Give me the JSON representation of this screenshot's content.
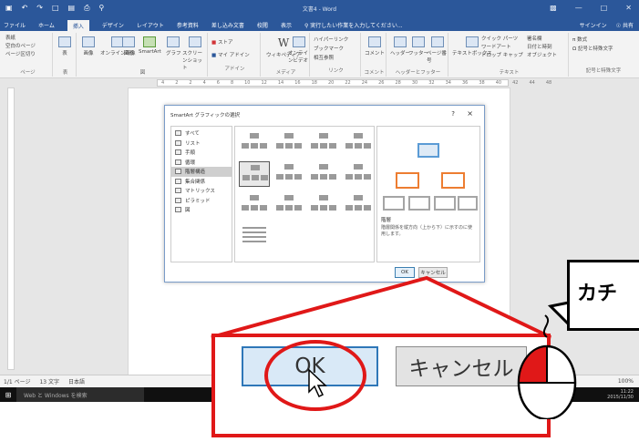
{
  "window": {
    "title": "文書4 - Word",
    "user": "サインイン",
    "share": "共有",
    "tell_me": "実行したい作業を入力してください..."
  },
  "ribbon_tabs": [
    "ファイル",
    "ホーム",
    "挿入",
    "デザイン",
    "レイアウト",
    "参考資料",
    "差し込み文書",
    "校閲",
    "表示"
  ],
  "ribbon": {
    "pages_group": {
      "items": [
        "表紙",
        "空白のページ",
        "ページ区切り"
      ],
      "label": "ページ"
    },
    "table_group": {
      "button": "表",
      "label": "表"
    },
    "illustrations_group": {
      "buttons": [
        "画像",
        "オンライン画像",
        "図形",
        "SmartArt",
        "グラフ",
        "スクリーンショット"
      ],
      "label": "図"
    },
    "addins_group": {
      "items": [
        "ストア",
        "マイ アドイン"
      ],
      "label": "アドイン"
    },
    "media_group": {
      "buttons": [
        "ウィキペディア",
        "オンラインビデオ"
      ],
      "label": "メディア"
    },
    "links_group": {
      "items": [
        "ハイパーリンク",
        "ブックマーク",
        "相互参照"
      ],
      "label": "リンク"
    },
    "comments_group": {
      "button": "コメント",
      "label": "コメント"
    },
    "header_group": {
      "buttons": [
        "ヘッダー",
        "フッター",
        "ページ番号"
      ],
      "label": "ヘッダーとフッター"
    },
    "text_group": {
      "buttons": [
        "テキストボックス"
      ],
      "items": [
        "クイック パーツ",
        "ワードアート",
        "ドロップ キャップ",
        "署名欄",
        "日付と時刻",
        "オブジェクト"
      ],
      "label": "テキスト"
    },
    "symbols_group": {
      "items": [
        "数式",
        "記号と特殊文字"
      ],
      "label": "記号と特殊文字"
    }
  },
  "ruler_ticks": [
    "4",
    "2",
    "2",
    "4",
    "6",
    "8",
    "10",
    "12",
    "14",
    "16",
    "18",
    "20",
    "22",
    "24",
    "26",
    "28",
    "30",
    "32",
    "34",
    "36",
    "38",
    "40",
    "42",
    "44",
    "48"
  ],
  "dialog": {
    "title": "SmartArt グラフィックの選択",
    "help": "?",
    "close": "×",
    "categories": [
      "すべて",
      "リスト",
      "手順",
      "循環",
      "階層構造",
      "集合関係",
      "マトリックス",
      "ピラミッド",
      "図"
    ],
    "selected_category": "階層構造",
    "preview_name": "階層",
    "preview_description": "階層関係を縦方向（上から下）に示すのに使用します。",
    "ok": "OK",
    "cancel": "キャンセル"
  },
  "statusbar": {
    "page": "1/1 ページ",
    "words": "13 文字",
    "lang": "日本語",
    "zoom": "100%"
  },
  "taskbar": {
    "search": "Web と Windows を検索",
    "time": "11:22",
    "date": "2015/11/30"
  },
  "callout": {
    "ok": "OK",
    "cancel": "キャンセル",
    "speech": "カチ"
  },
  "colors": {
    "accent": "#2b579a",
    "highlight": "#e01818",
    "ok_focus": "#2e77b8"
  }
}
